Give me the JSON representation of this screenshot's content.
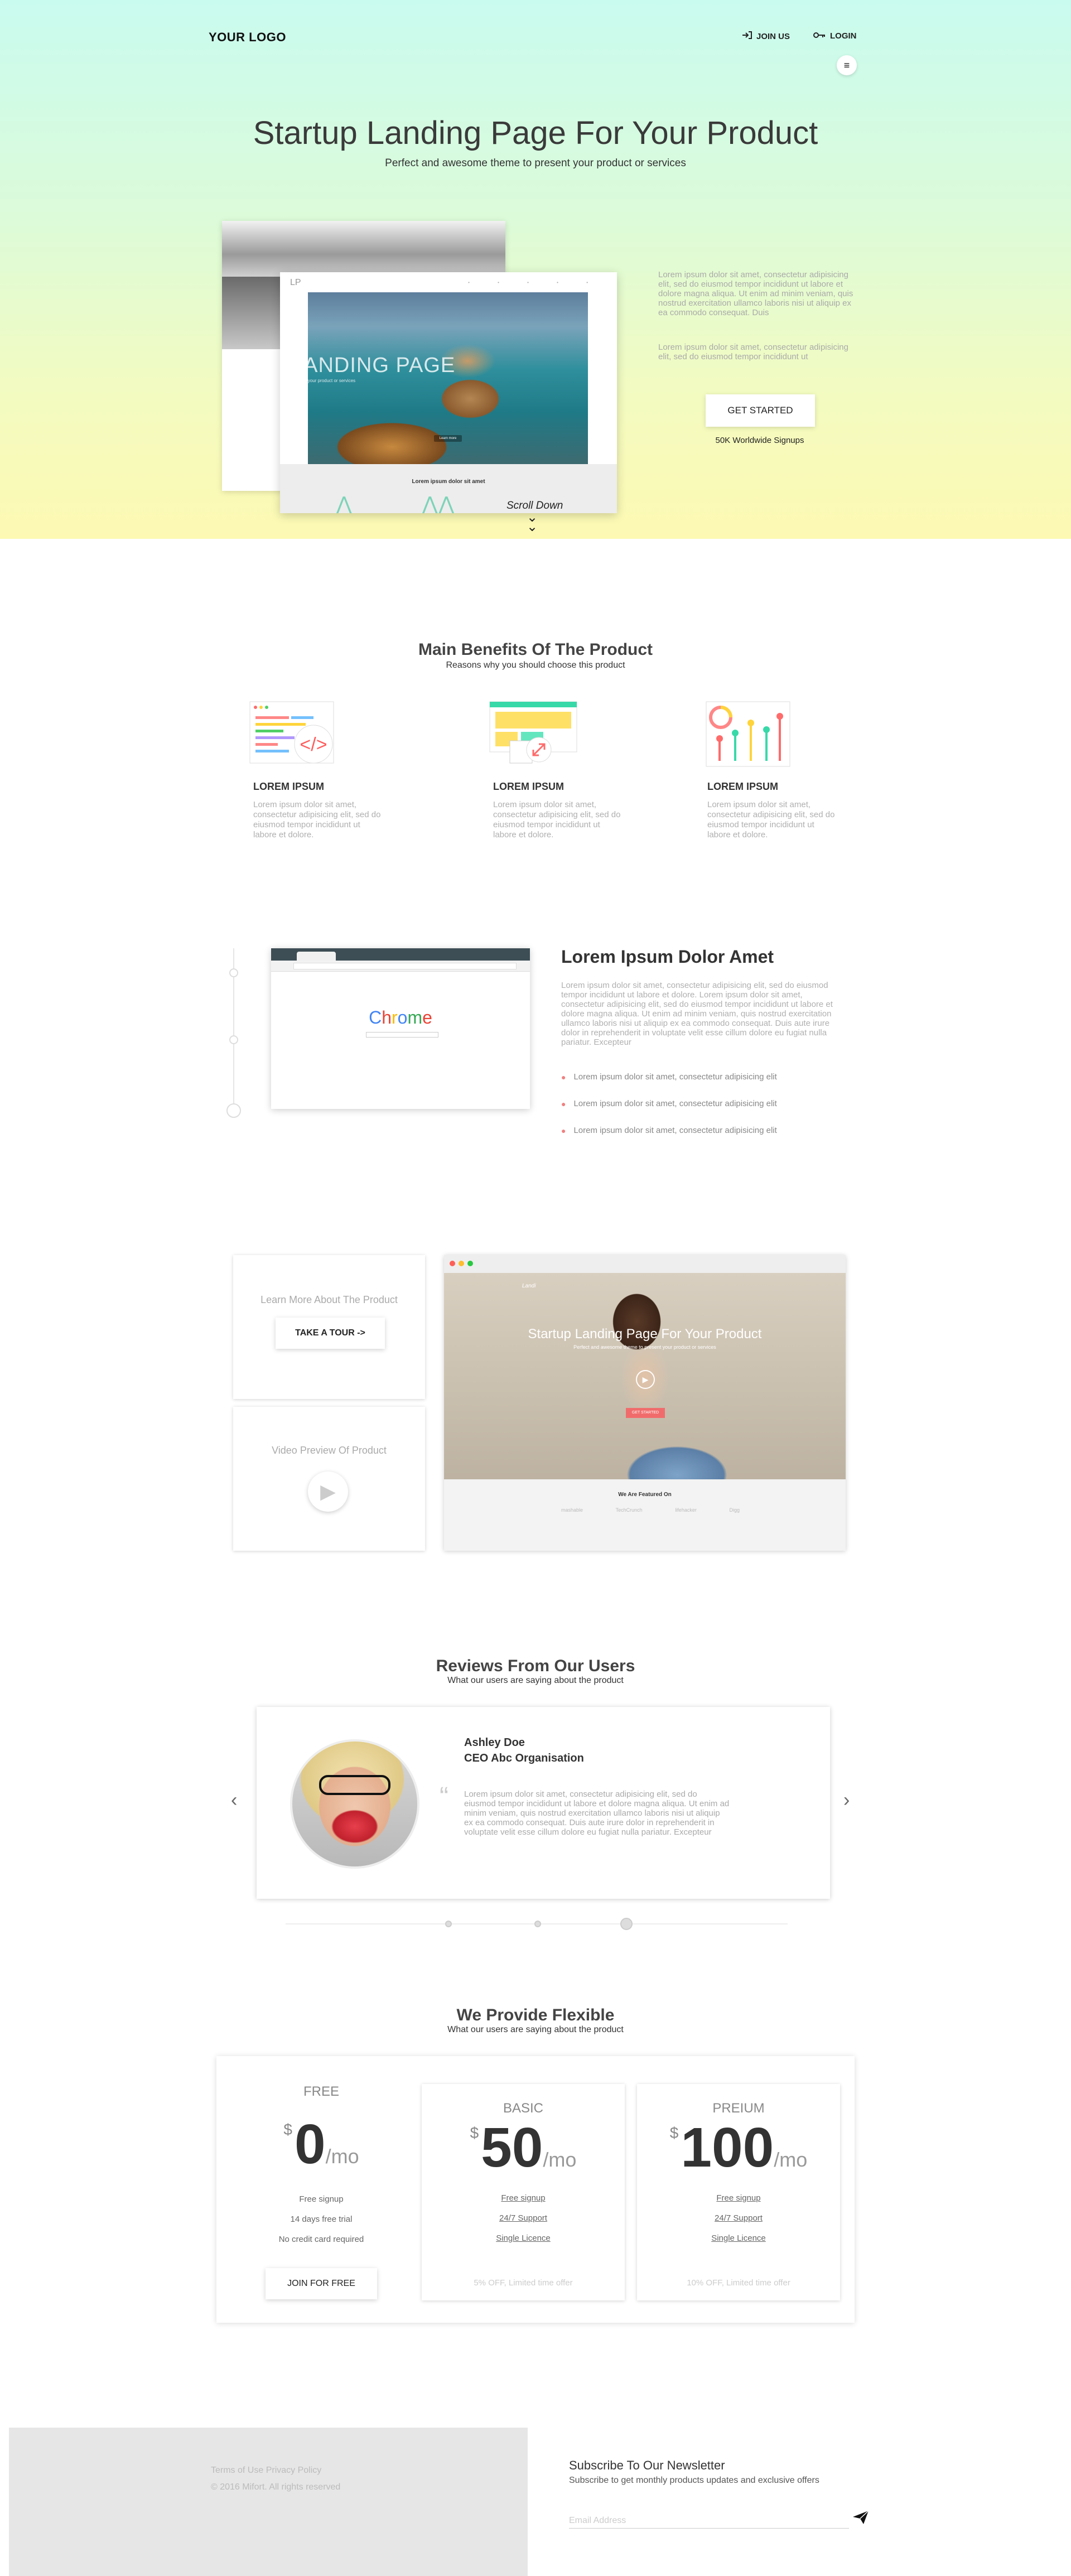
{
  "header": {
    "logo": "YOUR LOGO",
    "join_label": "JOIN US",
    "login_label": "LOGIN",
    "menu_icon": "hamburger-icon"
  },
  "hero": {
    "title": "Startup Landing Page For Your Product",
    "subtitle": "Perfect and awesome theme to present your product or services",
    "mockup": {
      "logo": "LP",
      "nav": "• • • • •",
      "title": "LANDING PAGE",
      "tagline": "Present your product or services",
      "button": "Learn more",
      "featured_title": "Lorem ipsum dolor sit amet"
    },
    "paragraph1": "Lorem ipsum dolor sit amet, consectetur adipisicing elit, sed do eiusmod tempor incididunt ut labore et dolore magna aliqua. Ut enim ad minim veniam, quis nostrud exercitation ullamco laboris nisi ut aliquip ex ea commodo consequat. Duis",
    "paragraph2": "Lorem ipsum dolor sit amet, consectetur adipisicing elit, sed do eiusmod tempor incididunt ut",
    "cta": "GET STARTED",
    "signups": "50K Worldwide Signups",
    "scroll_label": "Scroll Down"
  },
  "benefits": {
    "title": "Main Benefits Of The Product",
    "subtitle": "Reasons why you should choose this product",
    "items": [
      {
        "icon": "code-window-icon",
        "heading": "LOREM IPSUM",
        "text": "Lorem ipsum dolor sit amet, consectetur adipisicing elit, sed do eiusmod tempor incididunt ut labore et dolore."
      },
      {
        "icon": "responsive-resize-icon",
        "heading": "LOREM IPSUM",
        "text": "Lorem ipsum dolor sit amet, consectetur adipisicing elit, sed do eiusmod tempor incididunt ut labore et dolore."
      },
      {
        "icon": "analytics-chart-icon",
        "heading": "LOREM IPSUM",
        "text": "Lorem ipsum dolor sit amet, consectetur adipisicing elit, sed do eiusmod tempor incididunt ut labore et dolore."
      }
    ]
  },
  "feature": {
    "browser_brand": "Chrome",
    "title": "Lorem Ipsum Dolor Amet",
    "text": "Lorem ipsum dolor sit amet, consectetur adipisicing elit, sed do eiusmod tempor incididunt ut labore et dolore. Lorem ipsum dolor sit amet, consectetur adipisicing elit, sed do eiusmod tempor incididunt ut labore et dolore magna aliqua. Ut enim ad minim veniam, quis nostrud exercitation ullamco laboris nisi ut aliquip ex ea commodo consequat. Duis aute irure dolor in reprehenderit in voluptate velit esse cillum dolore eu fugiat nulla pariatur. Excepteur",
    "bullets": [
      "Lorem ipsum dolor sit amet, consectetur adipisicing elit",
      "Lorem ipsum dolor sit amet, consectetur adipisicing elit",
      "Lorem ipsum dolor sit amet, consectetur adipisicing elit"
    ]
  },
  "tour": {
    "label": "Learn More About The Product",
    "button": "TAKE A TOUR ->",
    "video_label": "Video Preview Of Product",
    "video": {
      "logo": "Landi",
      "title": "Startup Landing Page For Your Product",
      "subtitle": "Perfect and awesome theme to present your product or services",
      "button": "GET STARTED",
      "featured_title": "We Are Featured On",
      "featured_logos": [
        "mashable",
        "TechCrunch",
        "lifehacker",
        "Digg"
      ]
    }
  },
  "reviews": {
    "title": "Reviews From Our Users",
    "subtitle": "What our users are saying about the product",
    "name": "Ashley Doe",
    "role": "CEO Abc Organisation",
    "quote_mark": "“",
    "text": "Lorem ipsum dolor sit amet, consectetur adipisicing elit, sed do eiusmod tempor incididunt ut labore et dolore magna aliqua. Ut enim ad minim veniam, quis nostrud exercitation ullamco laboris nisi ut aliquip ex ea commodo consequat. Duis aute irure dolor in reprehenderit in voluptate velit esse cillum dolore eu fugiat nulla pariatur. Excepteur",
    "prev_icon": "chevron-left-icon",
    "next_icon": "chevron-right-icon"
  },
  "pricing": {
    "title": "We Provide Flexible",
    "subtitle": "What our users are saying about the product",
    "plans": [
      {
        "name": "FREE",
        "currency": "$",
        "price": "0",
        "period": "/mo",
        "features": [
          "Free signup",
          "14 days free trial",
          "No credit card required"
        ],
        "button": "JOIN FOR FREE"
      },
      {
        "name": "BASIC",
        "currency": "$",
        "price": "50",
        "period": "/mo",
        "features": [
          "Free signup",
          "24/7 Support",
          "Single Licence"
        ],
        "offer": "5% OFF, Limited time offer"
      },
      {
        "name": "PREIUM",
        "currency": "$",
        "price": "100",
        "period": "/mo",
        "features": [
          "Free signup",
          "24/7 Support",
          "Single Licence"
        ],
        "offer": "10% OFF, Limited time offer"
      }
    ]
  },
  "footer": {
    "links": "Terms of Use Privacy Policy",
    "copyright": "© 2016 Mifort. All rights reserved",
    "newsletter_title": "Subscribe To Our Newsletter",
    "newsletter_sub": "Subscribe to get monthly products updates and exclusive offers",
    "email_placeholder": "Email Address",
    "send_icon": "paper-plane-icon"
  },
  "colors": {
    "hero_top": "#c9fbef",
    "hero_bottom": "#fdf9b3",
    "bullet": "#f08080",
    "footer_bg": "#e6e6e6"
  }
}
